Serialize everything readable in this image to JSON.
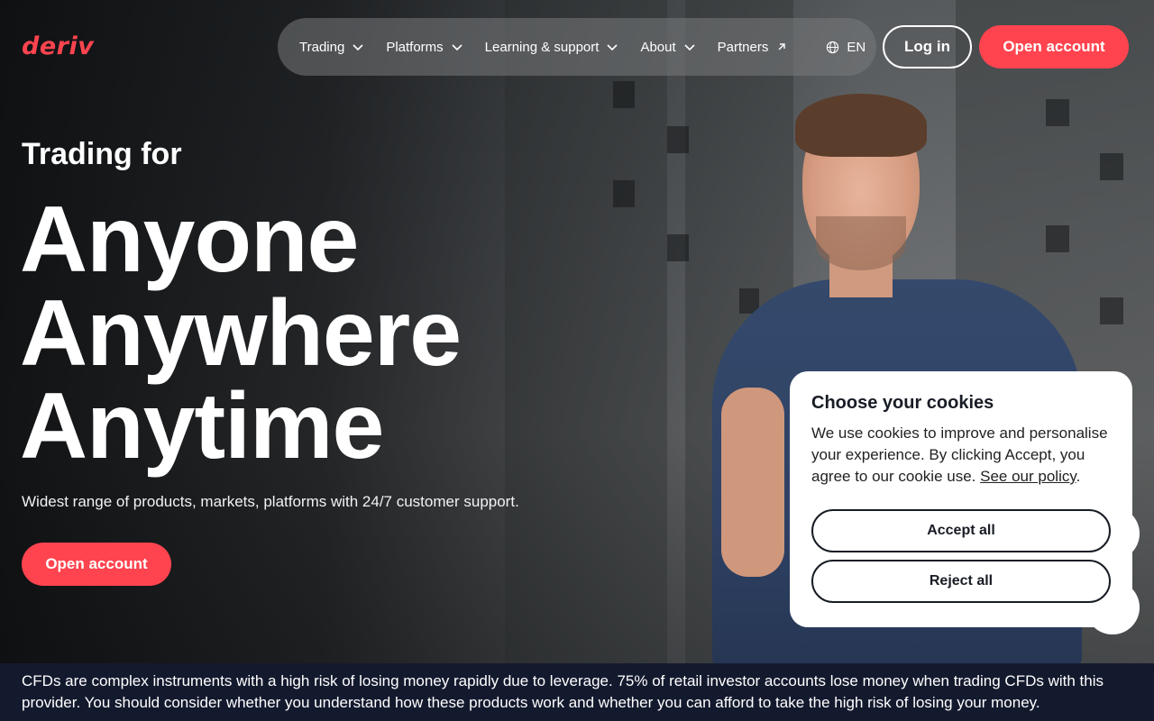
{
  "header": {
    "logo_text": "deriv",
    "nav": [
      {
        "label": "Trading",
        "has_chevron": true
      },
      {
        "label": "Platforms",
        "has_chevron": true
      },
      {
        "label": "Learning & support",
        "has_chevron": true
      },
      {
        "label": "About",
        "has_chevron": true
      },
      {
        "label": "Partners",
        "external": true
      }
    ],
    "language": "EN",
    "login_label": "Log in",
    "open_account_label": "Open account"
  },
  "hero": {
    "kicker": "Trading for",
    "lines": [
      "Anyone",
      "Anywhere",
      "Anytime"
    ],
    "subtitle": "Widest range of products, markets, platforms with 24/7 customer support.",
    "cta_label": "Open account"
  },
  "cookie": {
    "title": "Choose your cookies",
    "body": "We use cookies to improve and personalise your experience. By clicking Accept, you agree to our cookie use.",
    "policy_link": "See our policy",
    "policy_suffix": ".",
    "accept_label": "Accept all",
    "reject_label": "Reject all"
  },
  "risk_warning": "CFDs are complex instruments with a high risk of losing money rapidly due to leverage. 75% of retail investor accounts lose money when trading CFDs with this provider. You should consider whether you understand how these products work and whether you can afford to take the high risk of losing your money.",
  "colors": {
    "brand_red": "#ff444f",
    "banner_navy": "#141a2e",
    "text_dark": "#181c25"
  }
}
